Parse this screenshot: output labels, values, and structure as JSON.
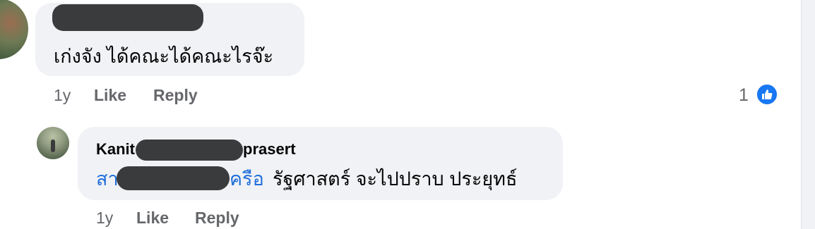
{
  "comments": [
    {
      "author": "",
      "text": "เก่งจัง ได้คณะได้คณะไรจ๊ะ",
      "age": "1y",
      "like_label": "Like",
      "reply_label": "Reply",
      "reaction_count": "1",
      "reaction_icon": "like-icon"
    },
    {
      "author_prefix": "Kanit",
      "author_suffix": "prasert",
      "mention_prefix": "สา",
      "mention_suffix": "ครือ",
      "text": "รัฐศาสตร์ จะไปปราบ ประยุทธ์",
      "age": "1y",
      "like_label": "Like",
      "reply_label": "Reply"
    }
  ],
  "colors": {
    "bubble": "#f0f2f5",
    "mention": "#216fdb",
    "muted": "#65676b",
    "like_blue": "#1877f2"
  }
}
